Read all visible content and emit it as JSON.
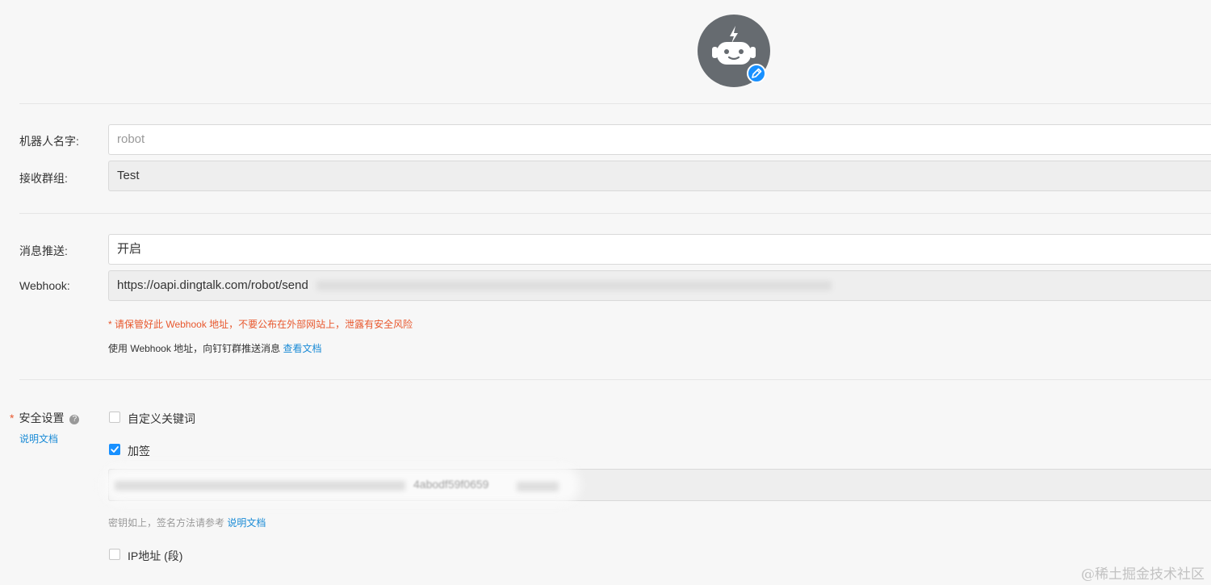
{
  "avatar": {
    "icon": "robot-icon",
    "edit_icon": "pencil-icon",
    "bg_color": "#666b70",
    "badge_color": "#1890ff"
  },
  "form": {
    "robot_name": {
      "label": "机器人名字:",
      "placeholder": "robot"
    },
    "group": {
      "label": "接收群组:",
      "value": "Test"
    },
    "push": {
      "label": "消息推送:",
      "value": "开启"
    },
    "webhook": {
      "label": "Webhook:",
      "value": "https://oapi.dingtalk.com/robot/send",
      "warning": "* 请保管好此 Webhook 地址，不要公布在外部网站上，泄露有安全风险",
      "usage_text": "使用 Webhook 地址，向钉钉群推送消息",
      "usage_link": "查看文档"
    },
    "security": {
      "label": "安全设置",
      "required_mark": "*",
      "help_icon": "question-circle-icon",
      "doc_link": "说明文档",
      "options": {
        "keyword": {
          "label": "自定义关键词",
          "checked": false
        },
        "sign": {
          "label": "加签",
          "checked": true
        },
        "ip": {
          "label": "IP地址 (段)",
          "checked": false
        }
      },
      "secret_fragment": "4abodf59f0659",
      "secret_hint": "密钥如上，签名方法请参考",
      "secret_hint_link": "说明文档"
    }
  },
  "watermark": "@稀土掘金技术社区"
}
